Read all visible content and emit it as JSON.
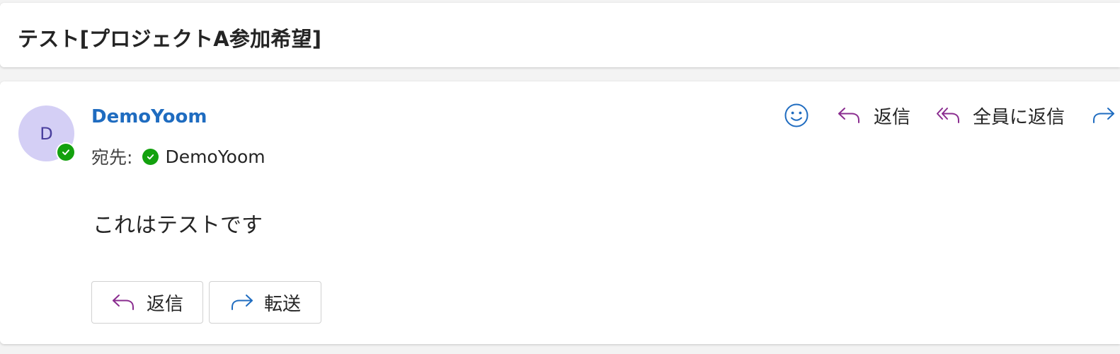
{
  "subject": {
    "title": "テスト[プロジェクトA参加希望]"
  },
  "message": {
    "avatar_initial": "D",
    "avatar_color": "#d4cff5",
    "presence_status": "available",
    "presence_color": "#13a10e",
    "sender_name": "DemoYoom",
    "to_label": "宛先:",
    "recipient_name": "DemoYoom",
    "body": "これはテストです"
  },
  "toolbar": {
    "emoji_icon": "emoji-smile-icon",
    "reply_label": "返信",
    "reply_icon": "reply-arrow-icon",
    "reply_all_label": "全員に返信",
    "reply_all_icon": "reply-all-arrow-icon",
    "forward_icon": "forward-arrow-icon"
  },
  "actions": {
    "reply_label": "返信",
    "forward_label": "転送"
  },
  "colors": {
    "accent_blue": "#1f6cc0",
    "reply_purple": "#8a2c8f",
    "forward_blue": "#1f6cc0"
  }
}
